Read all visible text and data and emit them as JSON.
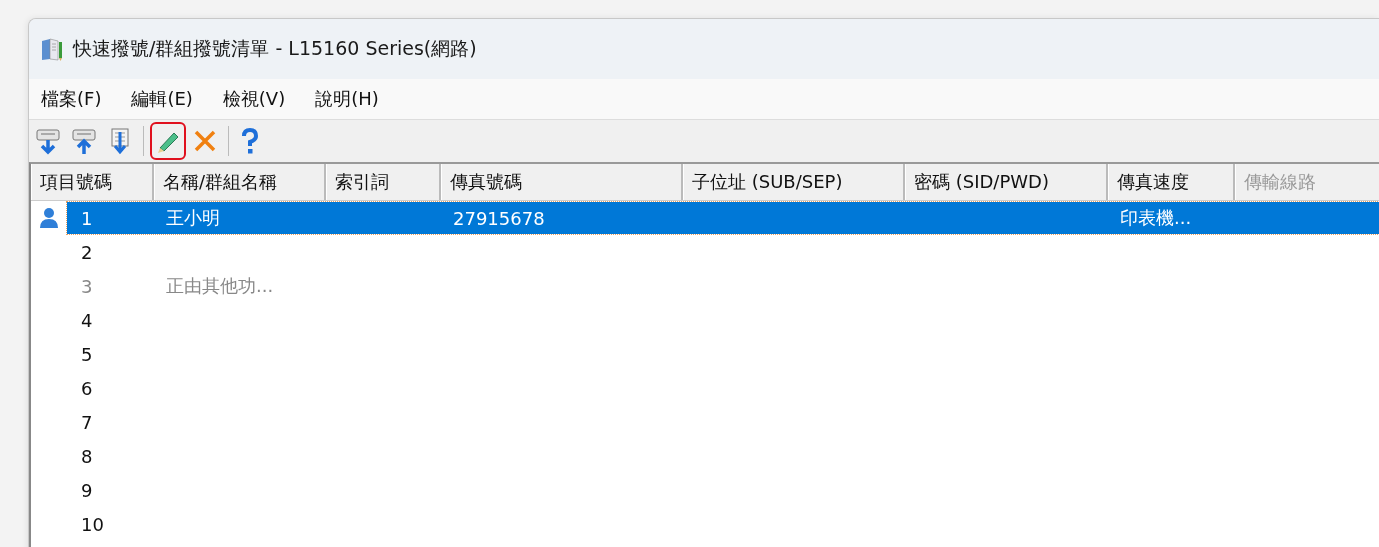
{
  "window": {
    "title": "快速撥號/群組撥號清單 - L15160 Series(網路)"
  },
  "menu": [
    {
      "label": "檔案(F)"
    },
    {
      "label": "編輯(E)"
    },
    {
      "label": "檢視(V)"
    },
    {
      "label": "說明(H)"
    }
  ],
  "toolbar": [
    {
      "kind": "download",
      "highlighted": false
    },
    {
      "kind": "upload",
      "highlighted": false
    },
    {
      "kind": "import",
      "highlighted": false
    },
    {
      "kind": "separator"
    },
    {
      "kind": "edit",
      "highlighted": true
    },
    {
      "kind": "delete",
      "highlighted": false
    },
    {
      "kind": "separator"
    },
    {
      "kind": "help",
      "highlighted": false
    }
  ],
  "table": {
    "columns": [
      {
        "label": "項目號碼",
        "disabled": false
      },
      {
        "label": "名稱/群組名稱",
        "disabled": false
      },
      {
        "label": "索引詞",
        "disabled": false
      },
      {
        "label": "傳真號碼",
        "disabled": false
      },
      {
        "label": "子位址 (SUB/SEP)",
        "disabled": false
      },
      {
        "label": "密碼 (SID/PWD)",
        "disabled": false
      },
      {
        "label": "傳真速度",
        "disabled": false
      },
      {
        "label": "傳輸線路",
        "disabled": true
      }
    ],
    "rows": [
      {
        "kind": "contact",
        "number": "1",
        "name": "王小明",
        "fax": "27915678",
        "speed": "印表機...",
        "selected": true,
        "disabled": false
      },
      {
        "kind": "empty",
        "number": "2",
        "selected": false,
        "disabled": false
      },
      {
        "kind": "empty",
        "number": "3",
        "name": "正由其他功...",
        "selected": false,
        "disabled": true
      },
      {
        "kind": "empty",
        "number": "4",
        "selected": false,
        "disabled": false
      },
      {
        "kind": "empty",
        "number": "5",
        "selected": false,
        "disabled": false
      },
      {
        "kind": "empty",
        "number": "6",
        "selected": false,
        "disabled": false
      },
      {
        "kind": "empty",
        "number": "7",
        "selected": false,
        "disabled": false
      },
      {
        "kind": "empty",
        "number": "8",
        "selected": false,
        "disabled": false
      },
      {
        "kind": "empty",
        "number": "9",
        "selected": false,
        "disabled": false
      },
      {
        "kind": "empty",
        "number": "10",
        "selected": false,
        "disabled": false
      }
    ]
  }
}
